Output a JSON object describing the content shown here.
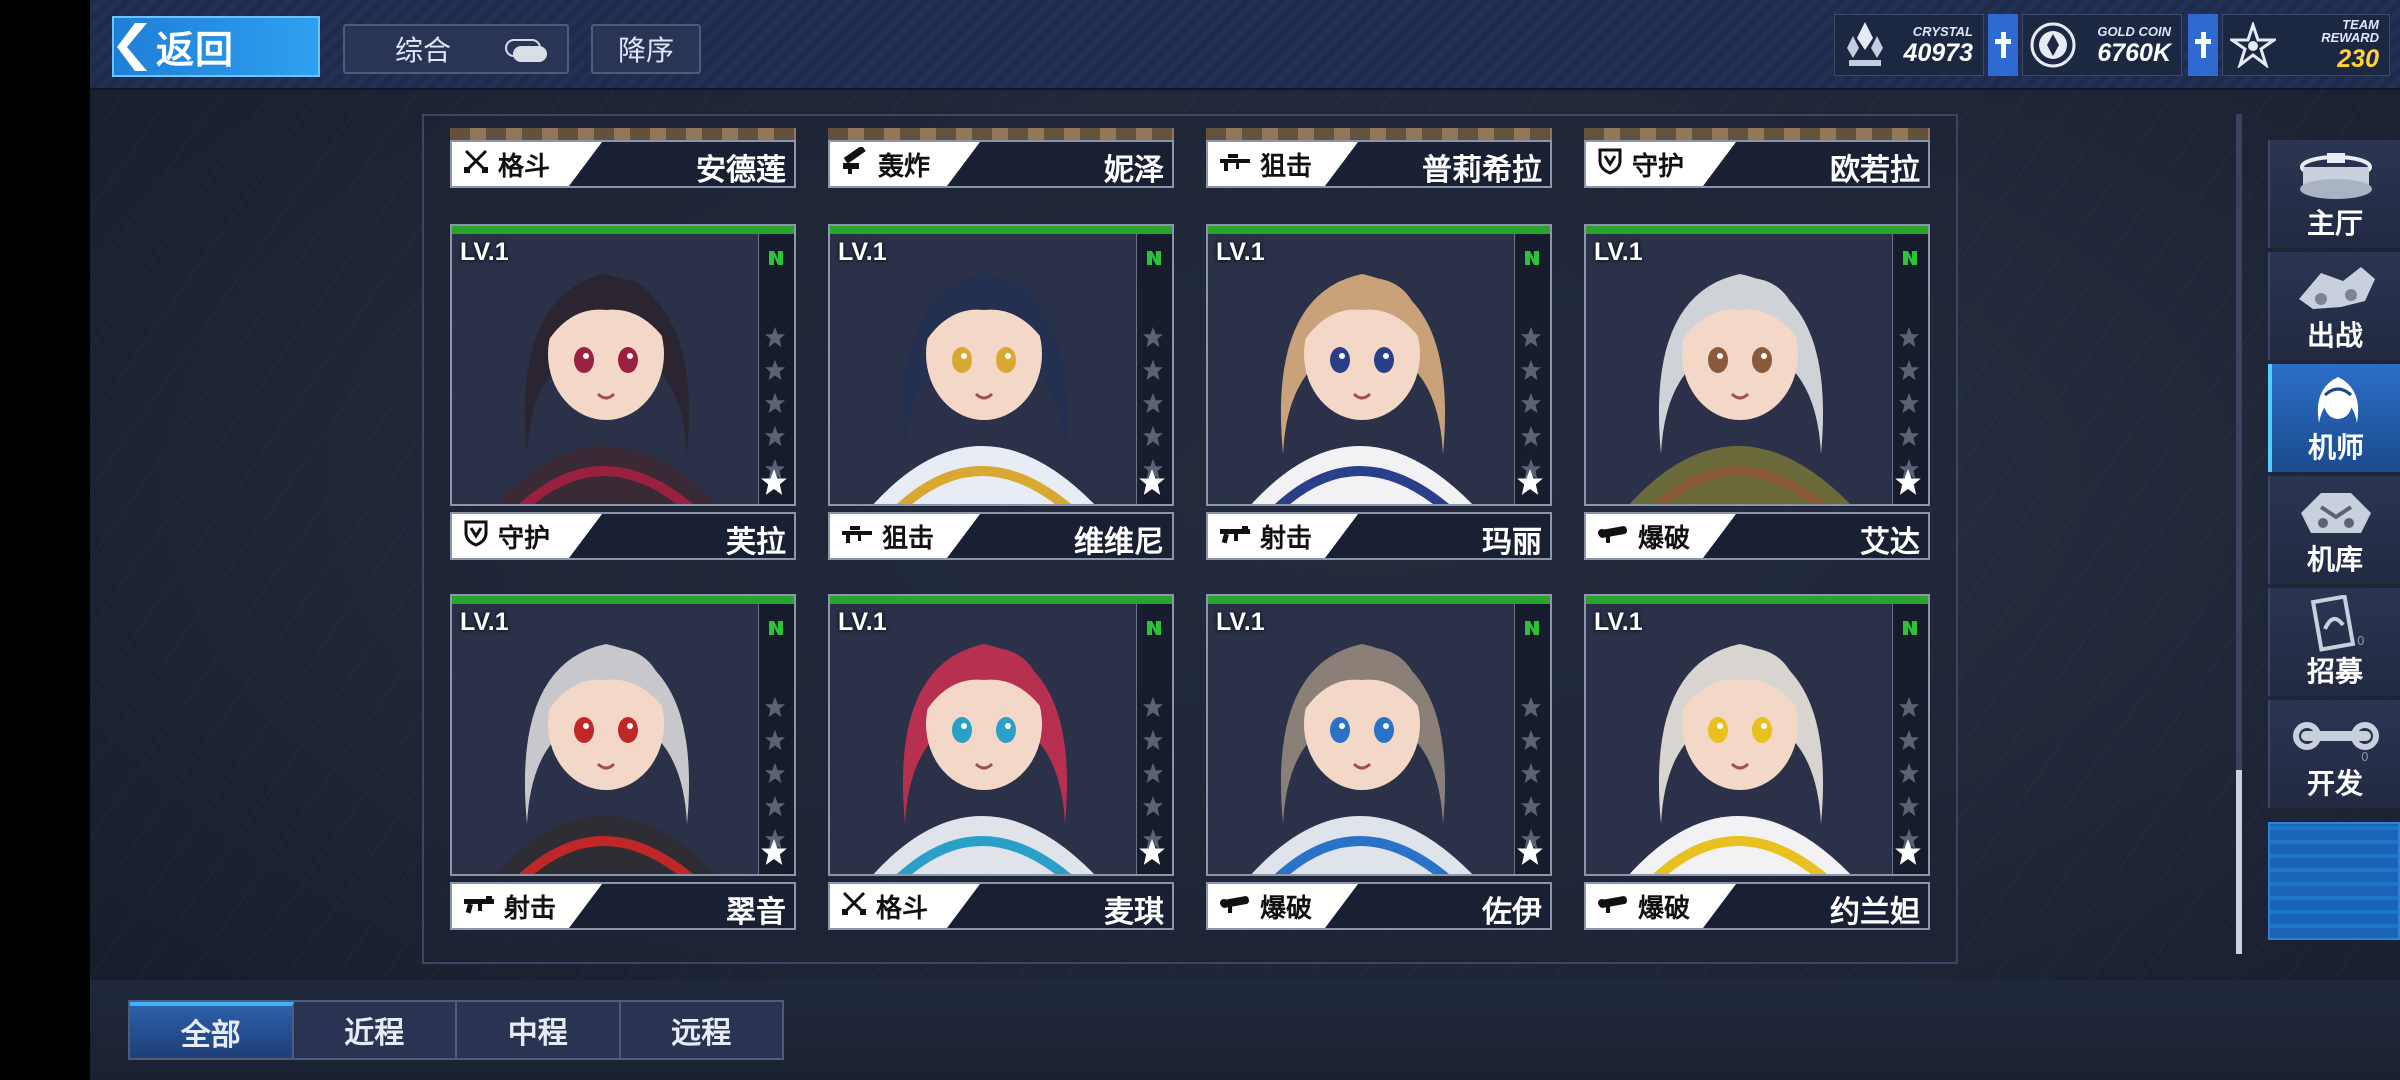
{
  "header": {
    "back_label": "返回",
    "sort_label": "综合",
    "order_label": "降序"
  },
  "resources": {
    "crystal": {
      "label": "CRYSTAL",
      "value": "40973"
    },
    "gold": {
      "label": "GOLD COIN",
      "value": "6760K"
    },
    "team": {
      "label": "TEAM REWARD",
      "value": "230"
    }
  },
  "partial_row": [
    {
      "role": "格斗",
      "role_icon": "swords-icon",
      "name": "安德莲"
    },
    {
      "role": "轰炸",
      "role_icon": "bomb-launcher-icon",
      "name": "妮泽"
    },
    {
      "role": "狙击",
      "role_icon": "sniper-rifle-icon",
      "name": "普莉希拉"
    },
    {
      "role": "守护",
      "role_icon": "shield-icon",
      "name": "欧若拉"
    }
  ],
  "cards": [
    {
      "level": "LV.1",
      "role": "守护",
      "role_icon": "shield-icon",
      "name": "芙拉",
      "hair": "#2a2530",
      "outfit": "#3a2a35",
      "accent": "#9a2040"
    },
    {
      "level": "LV.1",
      "role": "狙击",
      "role_icon": "sniper-rifle-icon",
      "name": "维维尼",
      "hair": "#24304f",
      "outfit": "#e8ecf5",
      "accent": "#d8a830"
    },
    {
      "level": "LV.1",
      "role": "射击",
      "role_icon": "rifle-icon",
      "name": "玛丽",
      "hair": "#c9a27a",
      "outfit": "#f2f2f5",
      "accent": "#2a3f8a"
    },
    {
      "level": "LV.1",
      "role": "爆破",
      "role_icon": "rocket-launcher-icon",
      "name": "艾达",
      "hair": "#cfd2d6",
      "outfit": "#6b6a3a",
      "accent": "#8a5a3a"
    },
    {
      "level": "LV.1",
      "role": "射击",
      "role_icon": "rifle-icon",
      "name": "翠音",
      "hair": "#c8c8cc",
      "outfit": "#2d2d33",
      "accent": "#c02828"
    },
    {
      "level": "LV.1",
      "role": "格斗",
      "role_icon": "swords-icon",
      "name": "麦琪",
      "hair": "#b83050",
      "outfit": "#e0e4ea",
      "accent": "#2aa0c8"
    },
    {
      "level": "LV.1",
      "role": "爆破",
      "role_icon": "rocket-launcher-icon",
      "name": "佐伊",
      "hair": "#8a8078",
      "outfit": "#dfe3ea",
      "accent": "#2a72c8"
    },
    {
      "level": "LV.1",
      "role": "爆破",
      "role_icon": "rocket-launcher-icon",
      "name": "约兰妲",
      "hair": "#d8d4d0",
      "outfit": "#f2f2f5",
      "accent": "#e8c020"
    }
  ],
  "rightnav": [
    {
      "label": "主厅",
      "icon": "hall-icon",
      "active": false
    },
    {
      "label": "出战",
      "icon": "sortie-icon",
      "active": false
    },
    {
      "label": "机师",
      "icon": "pilot-icon",
      "active": true
    },
    {
      "label": "机库",
      "icon": "hangar-icon",
      "active": false
    },
    {
      "label": "招募",
      "icon": "recruit-card-icon",
      "active": false
    },
    {
      "label": "开发",
      "icon": "develop-wrench-icon",
      "active": false
    }
  ],
  "tabs": [
    {
      "label": "全部",
      "active": true
    },
    {
      "label": "近程",
      "active": false
    },
    {
      "label": "中程",
      "active": false
    },
    {
      "label": "远程",
      "active": false
    }
  ],
  "colors": {
    "accent_blue": "#2fa0f0",
    "level_green": "#2aa32c",
    "team_reward_gold": "#ffd23a"
  }
}
